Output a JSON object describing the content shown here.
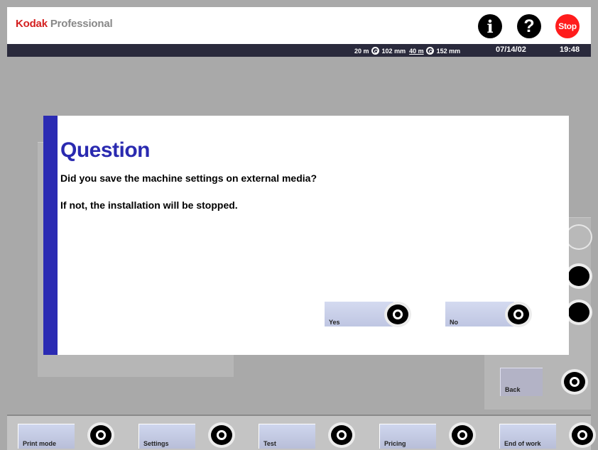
{
  "header": {
    "brand_primary": "Kodak",
    "brand_secondary": "Professional",
    "info_label": "i",
    "help_label": "?",
    "stop_label": "Stop"
  },
  "status": {
    "media1_length": "20 m",
    "media1_width": "102 mm",
    "media2_length": "40 m",
    "media2_width": "152 mm",
    "date": "07/14/02",
    "time": "19:48"
  },
  "dialog": {
    "title": "Question",
    "question": "Did you save the machine settings on external media?",
    "note": "If not, the installation will be stopped.",
    "yes_label": "Yes",
    "no_label": "No"
  },
  "side": {
    "back_label": "Back"
  },
  "softkeys": {
    "print_mode": "Print mode",
    "settings": "Settings",
    "test": "Test",
    "pricing": "Pricing",
    "end_of_work": "End of work"
  },
  "colors": {
    "accent_blue": "#2b2bb3",
    "stop_red": "#ff1c1c",
    "brand_red": "#d42020",
    "status_bar": "#2a2a3c"
  }
}
